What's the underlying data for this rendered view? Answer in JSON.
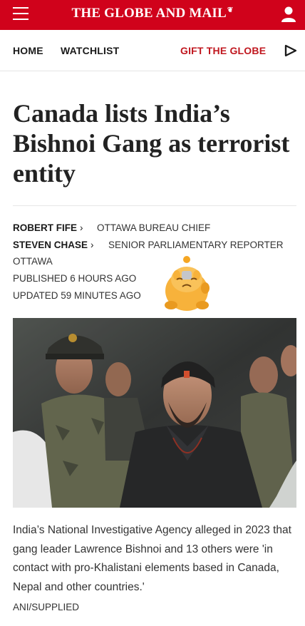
{
  "header": {
    "logo_text": "THE GLOBE AND MAIL",
    "logo_mark": "❦",
    "menu_icon": "hamburger-icon",
    "user_icon": "user-icon",
    "brand_color": "#d0021b"
  },
  "nav": {
    "home": "HOME",
    "watchlist": "WATCHLIST",
    "gift": "GIFT THE GLOBE",
    "play_icon": "play-icon",
    "gift_color": "#c0171f"
  },
  "article": {
    "headline": "Canada lists India’s Bishnoi Gang as terrorist entity",
    "authors": [
      {
        "name": "ROBERT FIFE",
        "role": "OTTAWA BUREAU CHIEF"
      },
      {
        "name": "STEVEN CHASE",
        "role": "SENIOR PARLIAMENTARY REPORTER"
      }
    ],
    "chevron": "›",
    "location": "OTTAWA",
    "published": "PUBLISHED 6 HOURS AGO",
    "updated": "UPDATED 59 MINUTES AGO",
    "caption": "India’s National Investigative Agency alleged in 2023 that gang leader Lawrence Bishnoi and 13 others were 'in contact with pro-Khalistani elements based in Canada, Nepal and other countries.'",
    "credit": "ANI/SUPPLIED"
  }
}
